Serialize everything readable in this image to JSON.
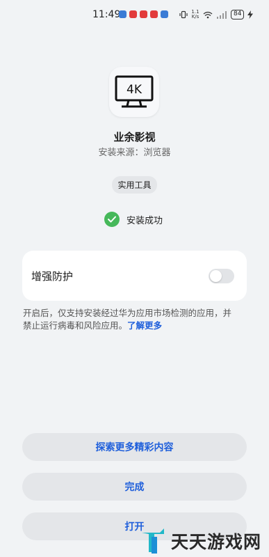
{
  "status_bar": {
    "time": "11:49",
    "network_speed": "1.1 K/s",
    "battery": "84",
    "notification_colors": [
      "#3a7bd5",
      "#e23b3b",
      "#e23b3b",
      "#e23b3b",
      "#3a7bd5"
    ]
  },
  "app": {
    "name": "业余影视",
    "source": "安装来源：浏览器",
    "category": "实用工具",
    "icon_text": "4K"
  },
  "status": {
    "text": "安装成功",
    "color": "#46b85a"
  },
  "protection": {
    "label": "增强防护",
    "enabled": false,
    "description": "开启后，仅支持安装经过华为应用市场检测的应用，并禁止运行病毒和风险应用。",
    "learn_more": "了解更多"
  },
  "buttons": {
    "explore": "探索更多精彩内容",
    "done": "完成",
    "open": "打开"
  },
  "watermark": {
    "text": "天天游戏网"
  },
  "colors": {
    "accent": "#1f5fdb",
    "background": "#f1f3f5",
    "card": "#ffffff",
    "button": "#e4e6e9"
  }
}
